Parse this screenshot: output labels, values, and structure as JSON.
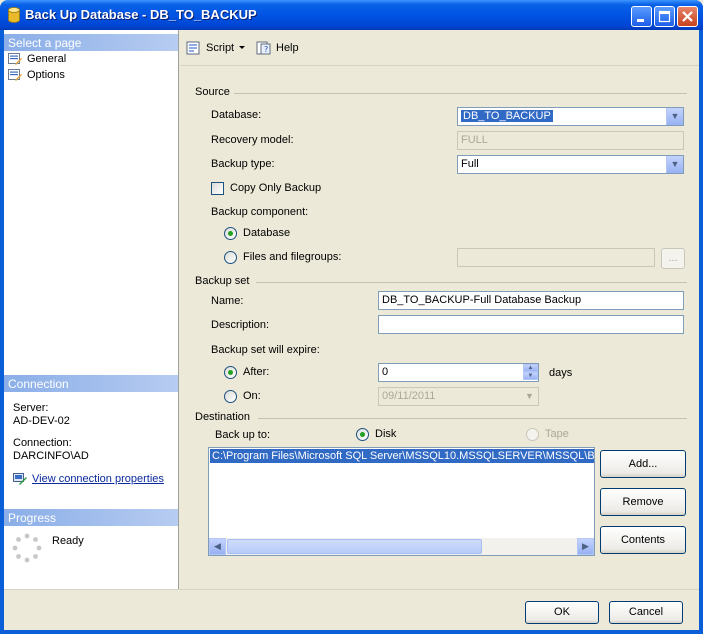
{
  "window": {
    "title": "Back Up Database - DB_TO_BACKUP"
  },
  "left_pane": {
    "select_page_header": "Select a page",
    "pages": [
      {
        "label": "General",
        "icon": "page-properties-icon"
      },
      {
        "label": "Options",
        "icon": "page-properties-icon"
      }
    ],
    "connection_header": "Connection",
    "server_label": "Server:",
    "server_value": "AD-DEV-02",
    "connection_label": "Connection:",
    "connection_value": "DARCINFO\\AD",
    "view_connection_link": "View connection properties",
    "progress_header": "Progress",
    "progress_status": "Ready"
  },
  "toolbar": {
    "script_label": "Script",
    "help_label": "Help"
  },
  "source": {
    "section_label": "Source",
    "database_label": "Database:",
    "database_value": "DB_TO_BACKUP",
    "recovery_model_label": "Recovery model:",
    "recovery_model_value": "FULL",
    "backup_type_label": "Backup type:",
    "backup_type_value": "Full",
    "copy_only_label": "Copy Only Backup",
    "copy_only_checked": false,
    "backup_component_label": "Backup component:",
    "component_database_label": "Database",
    "component_files_label": "Files and filegroups:",
    "component_selected": "Database",
    "browse_button_label": "..."
  },
  "backup_set": {
    "section_label": "Backup set",
    "name_label": "Name:",
    "name_value": "DB_TO_BACKUP-Full Database Backup",
    "description_label": "Description:",
    "description_value": "",
    "expire_label": "Backup set will expire:",
    "after_label": "After:",
    "after_value": "0",
    "after_unit": "days",
    "on_label": "On:",
    "on_value": "09/11/2011",
    "expire_selected": "After"
  },
  "destination": {
    "section_label": "Destination",
    "backup_to_label": "Back up to:",
    "disk_label": "Disk",
    "tape_label": "Tape",
    "selected": "Disk",
    "paths": [
      "C:\\Program Files\\Microsoft SQL Server\\MSSQL10.MSSQLSERVER\\MSSQL\\Backup\\DB_TO_BACKUP.bak"
    ],
    "add_button": "Add...",
    "remove_button": "Remove",
    "contents_button": "Contents"
  },
  "footer": {
    "ok_button": "OK",
    "cancel_button": "Cancel"
  },
  "colors": {
    "title_bar": "#0054E3",
    "selection": "#316AC5",
    "dialog_face": "#ECE9D8",
    "link": "#0B2A9E"
  }
}
